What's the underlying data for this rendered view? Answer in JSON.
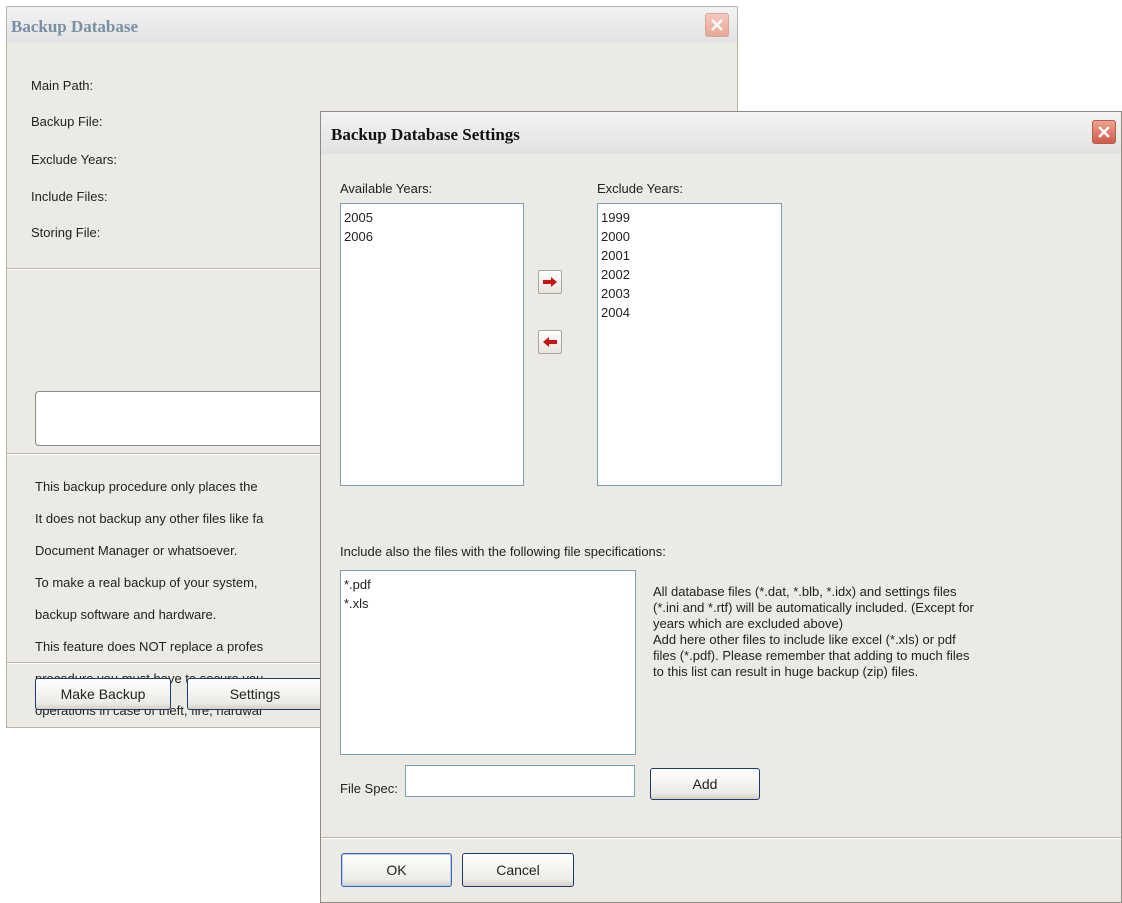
{
  "backup_window": {
    "title": "Backup Database",
    "fields": [
      "Main Path:",
      "Backup File:",
      "Exclude Years:",
      "Include Files:",
      "Storing File:"
    ],
    "description_lines": [
      "This backup procedure only places the",
      "It does not backup any other files like fa",
      "Document Manager or whatsoever.",
      "To make a real backup of your system,",
      "backup software and hardware.",
      "This feature does NOT replace a profes",
      "procedure you must have to secure you",
      "operations in case of theft, fire, hardwar"
    ],
    "make_backup_label": "Make Backup",
    "settings_label": "Settings"
  },
  "settings_window": {
    "title": "Backup Database Settings",
    "available_years_label": "Available Years:",
    "available_years": [
      "2005",
      "2006"
    ],
    "exclude_years_label": "Exclude Years:",
    "exclude_years": [
      "1999",
      "2000",
      "2001",
      "2002",
      "2003",
      "2004"
    ],
    "include_label": "Include also the files with the following file specifications:",
    "file_specs": [
      "*.pdf",
      "*.xls"
    ],
    "info_text": "All database files (*.dat, *.blb, *.idx) and settings files\n(*.ini and *.rtf) will be automatically included. (Except for\nyears which are excluded above)\nAdd here other files to include like excel (*.xls) or pdf\nfiles (*.pdf). Please remember that adding to much files\nto this list can result in huge backup (zip) files.",
    "file_spec_label": "File Spec:",
    "file_spec_value": "",
    "add_label": "Add",
    "ok_label": "OK",
    "cancel_label": "Cancel"
  },
  "colors": {
    "window_bg": "#ebeae5",
    "accent_arrow": "#c81414",
    "close_button": "#d05a45"
  }
}
